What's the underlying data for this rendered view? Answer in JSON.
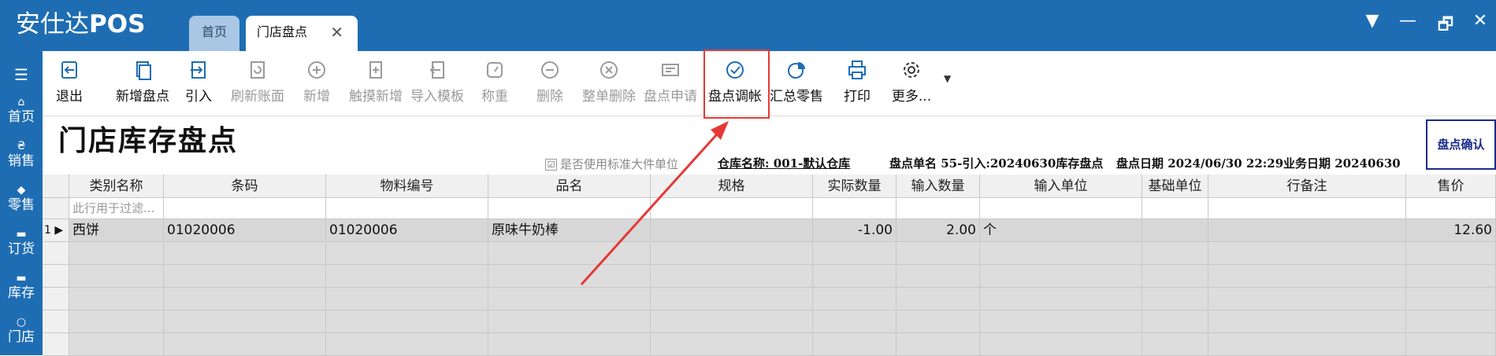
{
  "app": {
    "brand_text": "安仕达",
    "brand_bold": "POS",
    "window_controls": [
      "▼",
      "—",
      "🗗",
      "✕"
    ]
  },
  "tabs": [
    {
      "label": "首页"
    },
    {
      "label": "门店盘点",
      "close": "✕"
    }
  ],
  "left_nav": {
    "menu_icon": "☰",
    "items": [
      {
        "icon": "home-icon",
        "glyph": "⌂",
        "label": "首页"
      },
      {
        "icon": "yen-icon",
        "glyph": "₴",
        "label": "销售"
      },
      {
        "icon": "tag-icon",
        "glyph": "◆",
        "label": "零售"
      },
      {
        "icon": "cart-icon",
        "glyph": "▬",
        "label": "订货"
      },
      {
        "icon": "box-icon",
        "glyph": "▬",
        "label": "库存"
      },
      {
        "icon": "search-icon",
        "glyph": "○",
        "label": "门店"
      }
    ]
  },
  "toolbar": {
    "exit": "退出",
    "new_count": "新增盘点",
    "import": "引入",
    "refresh": "刷新账面",
    "add": "新增",
    "touch_add": "触摸新增",
    "import_template": "导入模板",
    "weigh": "称重",
    "delete": "删除",
    "delete_all": "整单删除",
    "apply": "盘点申请",
    "adjust": "盘点调帐",
    "summary": "汇总零售",
    "print": "打印",
    "more": "更多..."
  },
  "page": {
    "title": "门店库存盘点",
    "confirm_button": "盘点确认",
    "use_std_unit_label": "是否使用标准大件单位",
    "check_mark": "☑",
    "warehouse": "仓库名称: 001-默认仓库",
    "doc_no": "盘点单名 55-引入:20240630库存盘点",
    "count_date": "盘点日期 2024/06/30 22:29",
    "biz_date": "业务日期 20240630"
  },
  "grid": {
    "columns": [
      "类别名称",
      "条码",
      "物料编号",
      "品名",
      "规格",
      "实际数量",
      "输入数量",
      "输入单位",
      "基础单位",
      "行备注",
      "售价"
    ],
    "filter_placeholder": "此行用于过滤...",
    "rows": [
      {
        "index": "1",
        "marker": "▶",
        "category": "西饼",
        "barcode": "01020006",
        "material_no": "01020006",
        "name": "原味牛奶棒",
        "spec": "",
        "actual_qty": "-1.00",
        "input_qty": "2.00",
        "input_unit": "个",
        "base_unit": "",
        "remark": "",
        "price": "12.60"
      }
    ]
  },
  "colors": {
    "accent_blue": "#1e6db3",
    "highlight_red": "#e53935",
    "confirm_navy": "#1a2a8a"
  }
}
